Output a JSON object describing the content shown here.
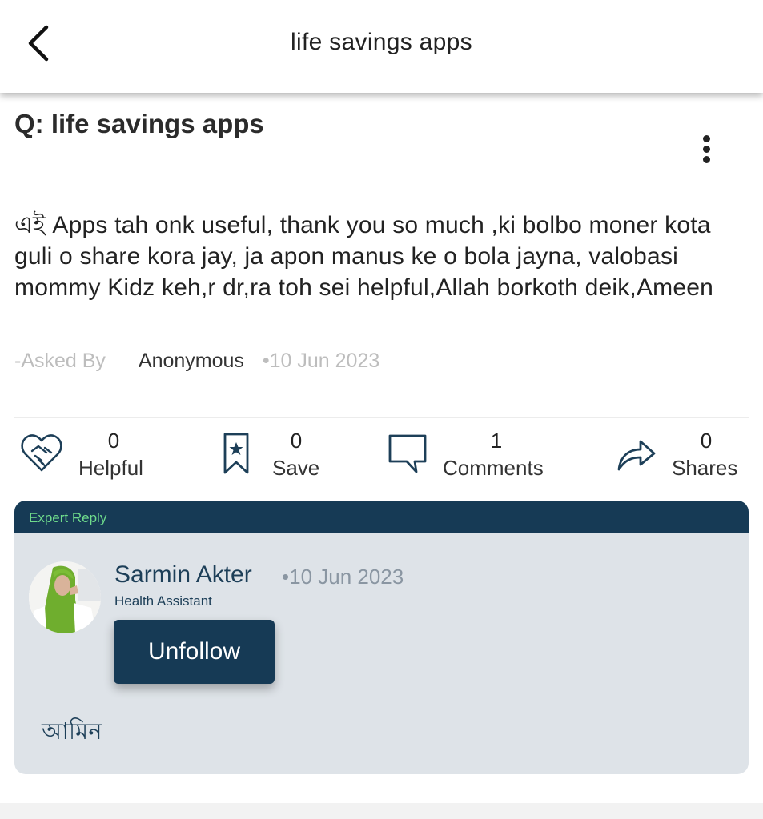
{
  "header": {
    "title": "life savings apps",
    "back_icon": "chevron-left-icon"
  },
  "question": {
    "title": "Q: life savings apps",
    "body": "এই Apps tah onk useful, thank you so much ,ki bolbo moner kota guli o share kora jay, ja apon manus ke o bola jayna, valobasi mommy Kidz keh,r dr,ra toh sei helpful,Allah borkoth deik,Ameen",
    "asked_by_label": "-Asked By",
    "author": "Anonymous",
    "date": "•10 Jun 2023",
    "more_icon": "more-vertical-icon"
  },
  "actions": {
    "helpful": {
      "count": "0",
      "label": "Helpful",
      "icon": "handshake-heart-icon"
    },
    "save": {
      "count": "0",
      "label": "Save",
      "icon": "bookmark-star-icon"
    },
    "comments": {
      "count": "1",
      "label": "Comments",
      "icon": "comment-icon"
    },
    "shares": {
      "count": "0",
      "label": "Shares",
      "icon": "share-arrow-icon"
    }
  },
  "expert_reply": {
    "header": "Expert Reply",
    "name": "Sarmin Akter",
    "date": "•10 Jun 2023",
    "role": "Health Assistant",
    "follow_button": "Unfollow",
    "reply": "আমিন"
  },
  "colors": {
    "accent": "#163a55",
    "expert_bg": "#dee3e8",
    "expert_header_text": "#6fdc8c"
  }
}
